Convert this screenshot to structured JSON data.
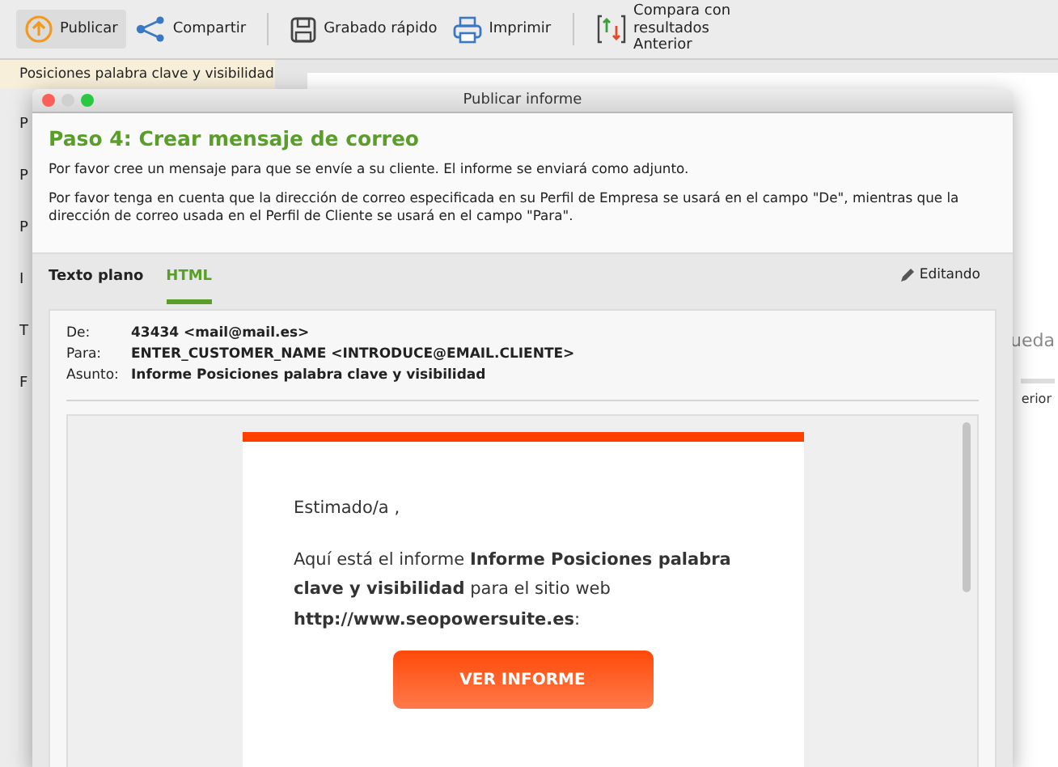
{
  "toolbar": {
    "groups": [
      [
        {
          "label": "Publicar",
          "selected": true
        },
        {
          "label": "Compartir",
          "selected": false
        }
      ],
      [
        {
          "label": "Grabado rápido",
          "selected": false
        },
        {
          "label": "Imprimir",
          "selected": false
        }
      ],
      [
        {
          "label": "Compara con resultados Anterior",
          "selected": false
        }
      ]
    ]
  },
  "sidebar": {
    "items": [
      {
        "label": "Posiciones palabra clave y visibilidad",
        "selected": true
      },
      {
        "label": "P",
        "selected": false
      },
      {
        "label": "P",
        "selected": false
      },
      {
        "label": "P",
        "selected": false
      },
      {
        "label": "I",
        "selected": false
      },
      {
        "label": "T",
        "selected": false
      },
      {
        "label": "F",
        "selected": false
      }
    ]
  },
  "background_fragments": [
    "ueda",
    "erior"
  ],
  "dialog": {
    "title": "Publicar informe",
    "heading": "Paso 4: Crear mensaje de correo",
    "paragraphs": [
      "Por favor cree un mensaje para que se envíe a su cliente. El informe se enviará como adjunto.",
      "Por favor tenga en cuenta que la dirección de correo especificada en su Perfil de Empresa se usará en el campo \"De\", mientras que la dirección de correo usada en el Perfil de Cliente se usará en el campo \"Para\"."
    ],
    "tabs": [
      {
        "label": "Texto plano",
        "selected": false
      },
      {
        "label": "HTML",
        "selected": true
      }
    ],
    "edit_status": "Editando",
    "email_headers": [
      {
        "label": "De:",
        "value": "43434 <mail@mail.es>"
      },
      {
        "label": "Para:",
        "value": "ENTER_CUSTOMER_NAME <INTRODUCE@EMAIL.CLIENTE>"
      },
      {
        "label": "Asunto:",
        "value": "Informe Posiciones palabra clave y visibilidad"
      }
    ],
    "email_body": {
      "greeting": "Estimado/a ,",
      "message": "Aquí está el informe **Informe Posiciones palabra clave y visibilidad** para el sitio web **http://www.seopowersuite.es**:",
      "button": "VER INFORME"
    }
  }
}
